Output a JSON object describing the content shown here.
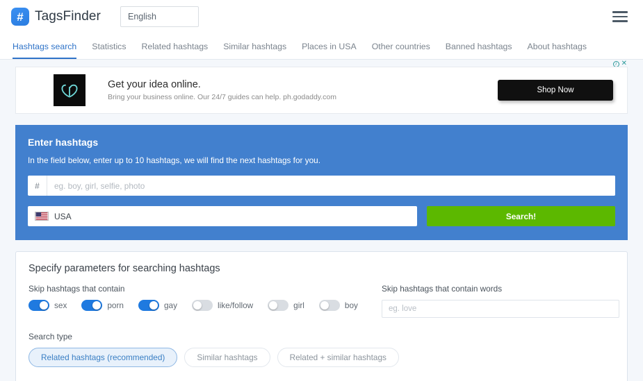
{
  "header": {
    "logo_icon": "hashtag-logo-icon",
    "logo_glyph": "#",
    "brand_name": "TagsFinder",
    "language_value": "English",
    "menu_icon": "hamburger-menu-icon"
  },
  "nav": {
    "items": [
      {
        "label": "Hashtags search",
        "active": true
      },
      {
        "label": "Statistics",
        "active": false
      },
      {
        "label": "Related hashtags",
        "active": false
      },
      {
        "label": "Similar hashtags",
        "active": false
      },
      {
        "label": "Places in USA",
        "active": false
      },
      {
        "label": "Other countries",
        "active": false
      },
      {
        "label": "Banned hashtags",
        "active": false
      },
      {
        "label": "About hashtags",
        "active": false
      }
    ]
  },
  "ad": {
    "info_icon": "adchoices-info-icon",
    "close_icon": "close-icon",
    "advertiser_logo": "godaddy-logo-icon",
    "title": "Get your idea online.",
    "subtitle": "Bring your business online. Our 24/7 guides can help. ph.godaddy.com",
    "cta_label": "Shop Now"
  },
  "search_panel": {
    "title": "Enter hashtags",
    "subtitle": "In the field below, enter up to 10 hashtags, we will find the next hashtags for you.",
    "hash_prefix": "#",
    "hashtag_placeholder": "eg. boy, girl, selfie, photo",
    "hashtag_value": "",
    "country_flag_icon": "usa-flag-icon",
    "country_value": "USA",
    "search_button_label": "Search!",
    "panel_color": "#4280ce",
    "search_button_color": "#5cb800"
  },
  "params": {
    "title": "Specify parameters for searching hashtags",
    "skip_contain_label": "Skip hashtags that contain",
    "toggles": [
      {
        "label": "sex",
        "on": true
      },
      {
        "label": "porn",
        "on": true
      },
      {
        "label": "gay",
        "on": true
      },
      {
        "label": "like/follow",
        "on": false
      },
      {
        "label": "girl",
        "on": false
      },
      {
        "label": "boy",
        "on": false
      }
    ],
    "skip_words_label": "Skip hashtags that contain words",
    "skip_words_placeholder": "eg. love",
    "skip_words_value": "",
    "search_type_label": "Search type",
    "search_types": [
      {
        "label": "Related hashtags (recommended)",
        "selected": true
      },
      {
        "label": "Similar hashtags",
        "selected": false
      },
      {
        "label": "Related + similar hashtags",
        "selected": false
      }
    ],
    "toggle_on_color": "#1f7ae0",
    "toggle_off_color": "#d9dde2"
  }
}
